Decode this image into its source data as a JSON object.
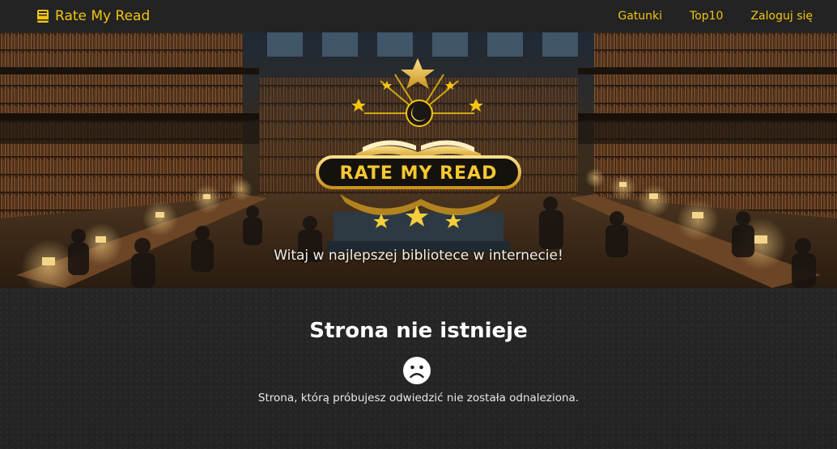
{
  "navbar": {
    "brand_name": "Rate My Read",
    "brand_icon": "book-icon",
    "links": [
      {
        "label": "Gatunki"
      },
      {
        "label": "Top10"
      },
      {
        "label": "Zaloguj się"
      }
    ]
  },
  "hero": {
    "logo_text": "RATE MY READ",
    "caption": "Witaj w najlepszej bibliotece w internecie!"
  },
  "error": {
    "title": "Strona nie istnieje",
    "icon": "sad-face-icon",
    "message": "Strona, którą próbujesz odwiedzić nie została odnaleziona."
  },
  "colors": {
    "accent": "#f2c511",
    "background": "#262626",
    "navbar": "#232323",
    "text": "#ffffff"
  }
}
